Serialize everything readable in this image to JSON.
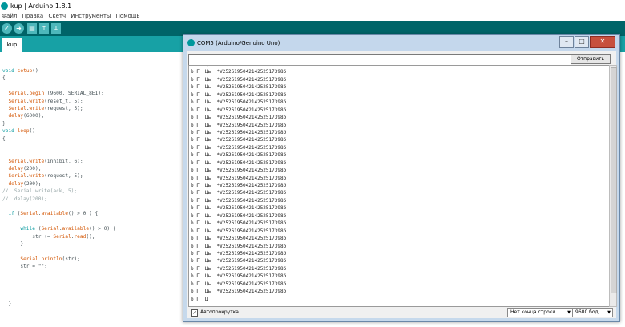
{
  "window": {
    "title": "kup | Arduino 1.8.1",
    "menu": [
      "Файл",
      "Правка",
      "Скетч",
      "Инструменты",
      "Помощь"
    ]
  },
  "toolbar": {
    "verify_icon": "check-icon",
    "upload_icon": "arrow-right-icon",
    "new_icon": "new-file-icon",
    "open_icon": "arrow-up-icon",
    "save_icon": "arrow-down-icon"
  },
  "tabs": [
    {
      "label": "kup"
    }
  ],
  "code": {
    "lines": [
      "void setup()",
      "{",
      "",
      "  Serial.begin (9600, SERIAL_8E1);",
      "  Serial.write(reset_t, 5);",
      "  Serial.write(request, 5);",
      "  delay(6000);",
      "}",
      "void loop()",
      "{",
      "",
      "",
      "  Serial.write(inhibit, 6);",
      "  delay(200);",
      "  Serial.write(request, 5);",
      "  delay(200);",
      "//  Serial.write(ack, 5);",
      "//  delay(200);",
      "",
      "  if (Serial.available() > 0 ) {",
      "",
      "      while (Serial.available() > 0) {",
      "          str += Serial.read();",
      "      }",
      "",
      "      Serial.println(str);",
      "      str = \"\";",
      "",
      "",
      "",
      "",
      "  }"
    ]
  },
  "serial_monitor": {
    "title": "COM5 (Arduino/Genuino Uno)",
    "input_value": "",
    "send_label": "Отправить",
    "output_lines": [
      "b Г  Ць  *V252619504214252517398б",
      "b Г  Ць  *V252619504214252517398б",
      "b Г  Ць  *V252619504214252517398б",
      "b Г  Ць  *V252619504214252517398б",
      "b Г  Ць  *V252619504214252517398б",
      "b Г  Ць  *V252619504214252517398б",
      "b Г  Ць  *V252619504214252517398б",
      "b Г  Ць  *V252619504214252517398б",
      "b Г  Ць  *V252619504214252517398б",
      "b Г  Ць  *V252619504214252517398б",
      "b Г  Ць  *V252619504214252517398б",
      "b Г  Ць  *V252619504214252517398б",
      "b Г  Ць  *V252619504214252517398б",
      "b Г  Ць  *V252619504214252517398б",
      "b Г  Ць  *V252619504214252517398б",
      "b Г  Ць  *V252619504214252517398б",
      "b Г  Ць  *V252619504214252517398б",
      "b Г  Ць  *V252619504214252517398б",
      "b Г  Ць  *V252619504214252517398б",
      "b Г  Ць  *V252619504214252517398б",
      "b Г  Ць  *V252619504214252517398б",
      "b Г  Ць  *V252619504214252517398б",
      "b Г  Ць  *V252619504214252517398б",
      "b Г  Ць  *V252619504214252517398б",
      "b Г  Ць  *V252619504214252517398б",
      "b Г  Ць  *V252619504214252517398б",
      "b Г  Ць  *V252619504214252517398б",
      "b Г  Ць  *V252619504214252517398б",
      "b Г  Ць  *V252619504214252517398б",
      "b Г  Ць  *V252619504214252517398б",
      "b Г  Ць  *V252619504214252517398б",
      "b Г  Ц"
    ],
    "autoscroll_label": "Автопрокрутка",
    "autoscroll_checked": true,
    "line_ending": "Нет конца строки",
    "baud": "9600 бод"
  }
}
